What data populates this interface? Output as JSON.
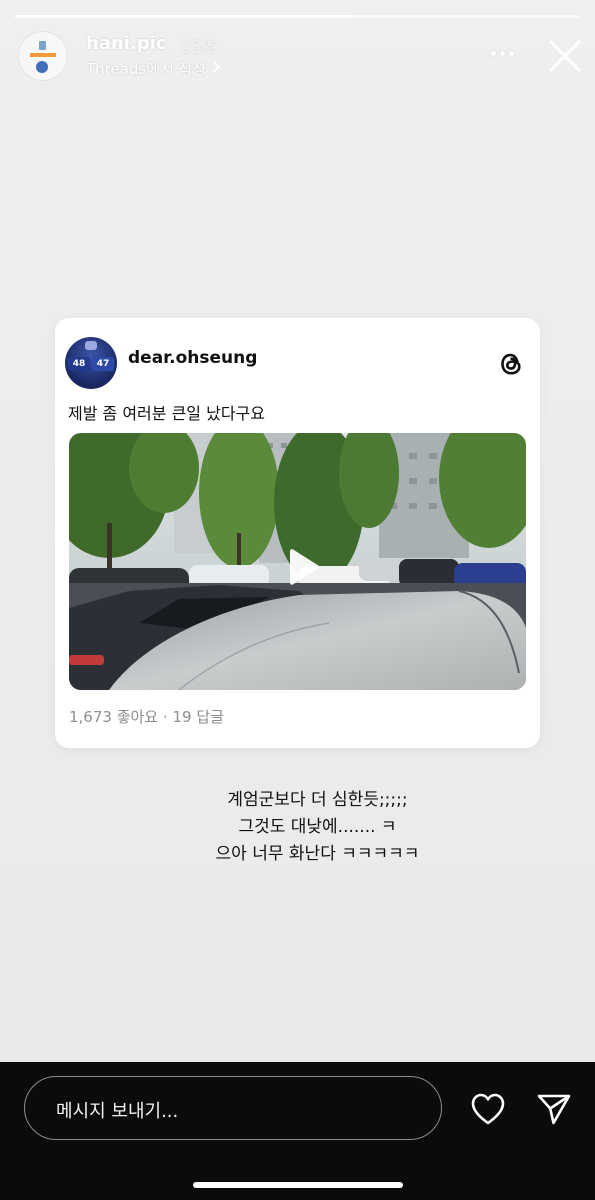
{
  "story": {
    "progress": 0.6,
    "username": "hani.pic",
    "time_ago": "25초",
    "source_label": "Threads에서 작성",
    "icons": {
      "avatar": "hani-pic-logo",
      "more": "more-horizontal-icon",
      "close": "close-icon",
      "chevron": "chevron-right-icon"
    }
  },
  "post": {
    "author": "dear.ohseung",
    "avatar_badges": [
      "48",
      "47"
    ],
    "text": "제발 좀 여러분 큰일 났다구요",
    "media_type": "video",
    "likes": "1,673 좋아요",
    "separator": "·",
    "replies": "19 답글",
    "icons": {
      "platform": "threads-logo-icon",
      "play": "play-icon"
    }
  },
  "caption": {
    "lines": [
      "계엄군보다 더 심한듯;;;;;",
      "그것도 대낮에....... ㅋ",
      "으아 너무 화난다 ㅋㅋㅋㅋㅋ"
    ]
  },
  "reply_bar": {
    "placeholder": "메시지 보내기...",
    "icons": {
      "like": "heart-icon",
      "share": "send-icon"
    }
  },
  "colors": {
    "story_background": "#eeeeee",
    "bottom_bar": "#0b0b0b",
    "card": "#ffffff",
    "muted_text": "#8e8e8e"
  }
}
